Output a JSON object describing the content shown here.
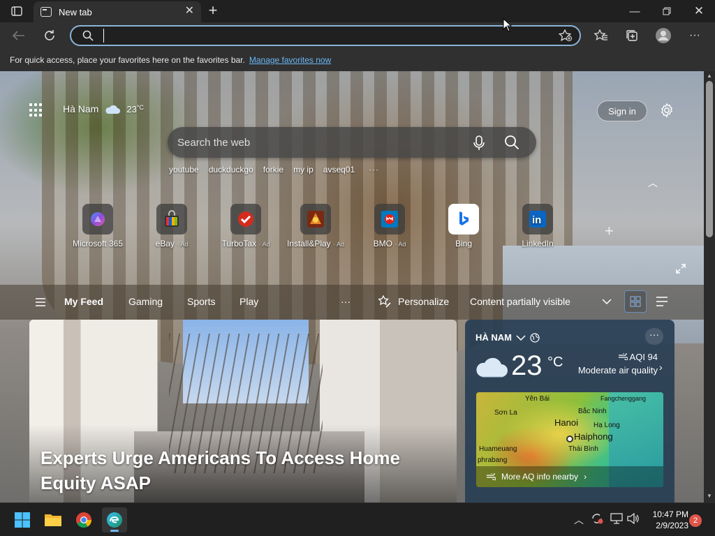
{
  "browser": {
    "tab_title": "New tab",
    "address_value": "",
    "favorites_bar_message": "For quick access, place your favorites here on the favorites bar.",
    "favorites_bar_link": "Manage favorites now"
  },
  "header": {
    "location": "Hà Nam",
    "temperature": "23",
    "temp_unit": "°C",
    "sign_in": "Sign in"
  },
  "search": {
    "placeholder": "Search the web",
    "trending": [
      "youtube",
      "duckduckgo",
      "forkie",
      "my ip",
      "avseq01"
    ],
    "more": "···"
  },
  "quick_links": [
    {
      "label": "Microsoft 365",
      "ad": "",
      "icon": "microsoft365-icon",
      "color": "#7b5cd6"
    },
    {
      "label": "eBay",
      "ad": "· Ad",
      "icon": "ebay-icon",
      "color": "#e53238"
    },
    {
      "label": "TurboTax",
      "ad": "· Ad",
      "icon": "turbotax-icon",
      "color": "#d52b1e"
    },
    {
      "label": "Install&Play",
      "ad": "· Ad",
      "icon": "installplay-icon",
      "color": "#c2401f"
    },
    {
      "label": "BMO",
      "ad": "· Ad",
      "icon": "bmo-icon",
      "color": "#0079c1"
    },
    {
      "label": "Bing",
      "ad": "",
      "icon": "bing-icon",
      "color": "#1a73e8"
    },
    {
      "label": "LinkedIn",
      "ad": "",
      "icon": "linkedin-icon",
      "color": "#0a66c2"
    }
  ],
  "feed": {
    "tabs": [
      "My Feed",
      "Gaming",
      "Sports",
      "Play"
    ],
    "more": "···",
    "personalize": "Personalize",
    "content_visibility": "Content partially visible"
  },
  "hero": {
    "headline": "Experts Urge Americans To Access Home Equity ASAP"
  },
  "weather": {
    "location": "HÀ NAM",
    "temperature": "23",
    "unit": "°C",
    "aqi": "AQI 94",
    "aqi_desc": "Moderate air quality",
    "map_labels": {
      "yenbai": "Yên Bái",
      "bacninh": "Bắc Ninh",
      "fangcheng": "Fangchenggang",
      "sonla": "Sơn La",
      "hanoi": "Hanoi",
      "halong": "Hạ Long",
      "haiphong": "Haiphong",
      "huameuang": "Huameuang",
      "thaibinh": "Thái Bình",
      "phrabang": "phrabang"
    },
    "more_aq": "More AQ info nearby"
  },
  "taskbar": {
    "time": "10:47 PM",
    "date": "2/9/2023",
    "notifications": "2"
  }
}
